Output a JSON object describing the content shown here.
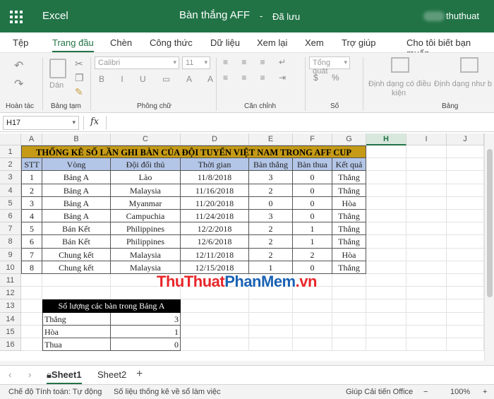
{
  "app": {
    "name": "Excel",
    "doc_title": "Bàn thắng AFF",
    "separator": "-",
    "save_status": "Đã lưu",
    "user": "thuthuat"
  },
  "menu": [
    "Tệp",
    "Trang đầu",
    "Chèn",
    "Công thức",
    "Dữ liệu",
    "Xem lại",
    "Xem",
    "Trợ giúp",
    "Cho tôi biết bạn muốn"
  ],
  "ribbon": {
    "groups": [
      "Hoàn tác",
      "Bảng tạm",
      "Phông chữ",
      "Căn chỉnh",
      "Số",
      "Bảng"
    ],
    "paste_label": "Dán",
    "font_name": "Calibri",
    "font_size": "11",
    "number_format": "Tổng quát",
    "cond_format_label_1": "Định dạng có điều",
    "cond_format_label_2": "kiện",
    "table_format_label": "Định dạng như b",
    "colors": {
      "accent": "#217346"
    }
  },
  "formula": {
    "namebox": "H17",
    "fx": "fx"
  },
  "columns": [
    "A",
    "B",
    "C",
    "D",
    "E",
    "F",
    "G",
    "H",
    "I",
    "J"
  ],
  "selected_column": "H",
  "rows": [
    "1",
    "2",
    "3",
    "4",
    "5",
    "6",
    "7",
    "8",
    "9",
    "10",
    "11",
    "12",
    "13",
    "14",
    "15",
    "16"
  ],
  "table": {
    "banner": "THỐNG KÊ SỐ LẦN GHI BÀN CỦA ĐỘI TUYỂN VIỆT NAM TRONG AFF CUP",
    "headers": [
      "STT",
      "Vòng",
      "Đội đối thủ",
      "Thời gian",
      "Bàn thắng",
      "Bàn thua",
      "Kết quả"
    ],
    "data": [
      [
        "1",
        "Bảng A",
        "Lào",
        "11/8/2018",
        "3",
        "0",
        "Thắng"
      ],
      [
        "2",
        "Bảng A",
        "Malaysia",
        "11/16/2018",
        "2",
        "0",
        "Thắng"
      ],
      [
        "3",
        "Bảng A",
        "Myanmar",
        "11/20/2018",
        "0",
        "0",
        "Hòa"
      ],
      [
        "4",
        "Bảng A",
        "Campuchia",
        "11/24/2018",
        "3",
        "0",
        "Thắng"
      ],
      [
        "5",
        "Bán Kết",
        "Philippines",
        "12/2/2018",
        "2",
        "1",
        "Thắng"
      ],
      [
        "6",
        "Bán Kết",
        "Philippines",
        "12/6/2018",
        "2",
        "1",
        "Thắng"
      ],
      [
        "7",
        "Chung kết",
        "Malaysia",
        "12/11/2018",
        "2",
        "2",
        "Hòa"
      ],
      [
        "8",
        "Chung kết",
        "Malaysia",
        "12/15/2018",
        "1",
        "0",
        "Thắng"
      ]
    ]
  },
  "summary": {
    "title": "Số lượng các bàn trong Bảng A",
    "rows": [
      [
        "Thắng",
        "3"
      ],
      [
        "Hòa",
        "1"
      ],
      [
        "Thua",
        "0"
      ]
    ]
  },
  "watermark": {
    "part1": "ThuThuat",
    "part2": "PhanMem",
    "part3": ".vn"
  },
  "sheets": [
    "Sheet1",
    "Sheet2"
  ],
  "status": {
    "calc_mode": "Chế độ Tính toán: Tự động",
    "workbook_stats": "Số liệu thống kê về sổ làm việc",
    "help_improve": "Giúp Cải tiến Office",
    "zoom": "100%"
  }
}
